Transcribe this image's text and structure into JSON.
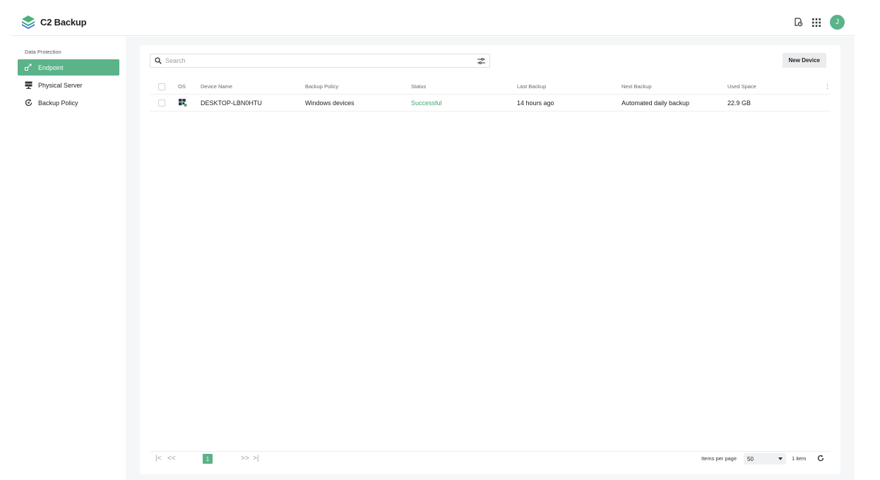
{
  "app": {
    "name": "C2 Backup"
  },
  "header": {
    "avatar_initial": "J",
    "brand_color": "#5bb389"
  },
  "sidebar": {
    "section": "Data Protection",
    "items": [
      {
        "label": "Endpoint",
        "icon": "endpoint-icon",
        "active": true
      },
      {
        "label": "Physical Server",
        "icon": "server-icon",
        "active": false
      },
      {
        "label": "Backup Policy",
        "icon": "backup-policy-icon",
        "active": false
      }
    ]
  },
  "toolbar": {
    "search_placeholder": "Search",
    "new_device_label": "New Device"
  },
  "table": {
    "columns": [
      "OS",
      "Device Name",
      "Backup Policy",
      "Status",
      "Last Backup",
      "Next Backup",
      "Used Space"
    ],
    "rows": [
      {
        "os": "windows-icon",
        "device_name": "DESKTOP-LBN0HTU",
        "backup_policy": "Windows devices",
        "status": "Successful",
        "last_backup": "14 hours ago",
        "next_backup": "Automated daily backup",
        "used_space": "22.9 GB"
      }
    ]
  },
  "pagination": {
    "current_page": "1",
    "items_per_page_label": "Items per page",
    "items_per_page": "50",
    "items_count": "1 item"
  }
}
